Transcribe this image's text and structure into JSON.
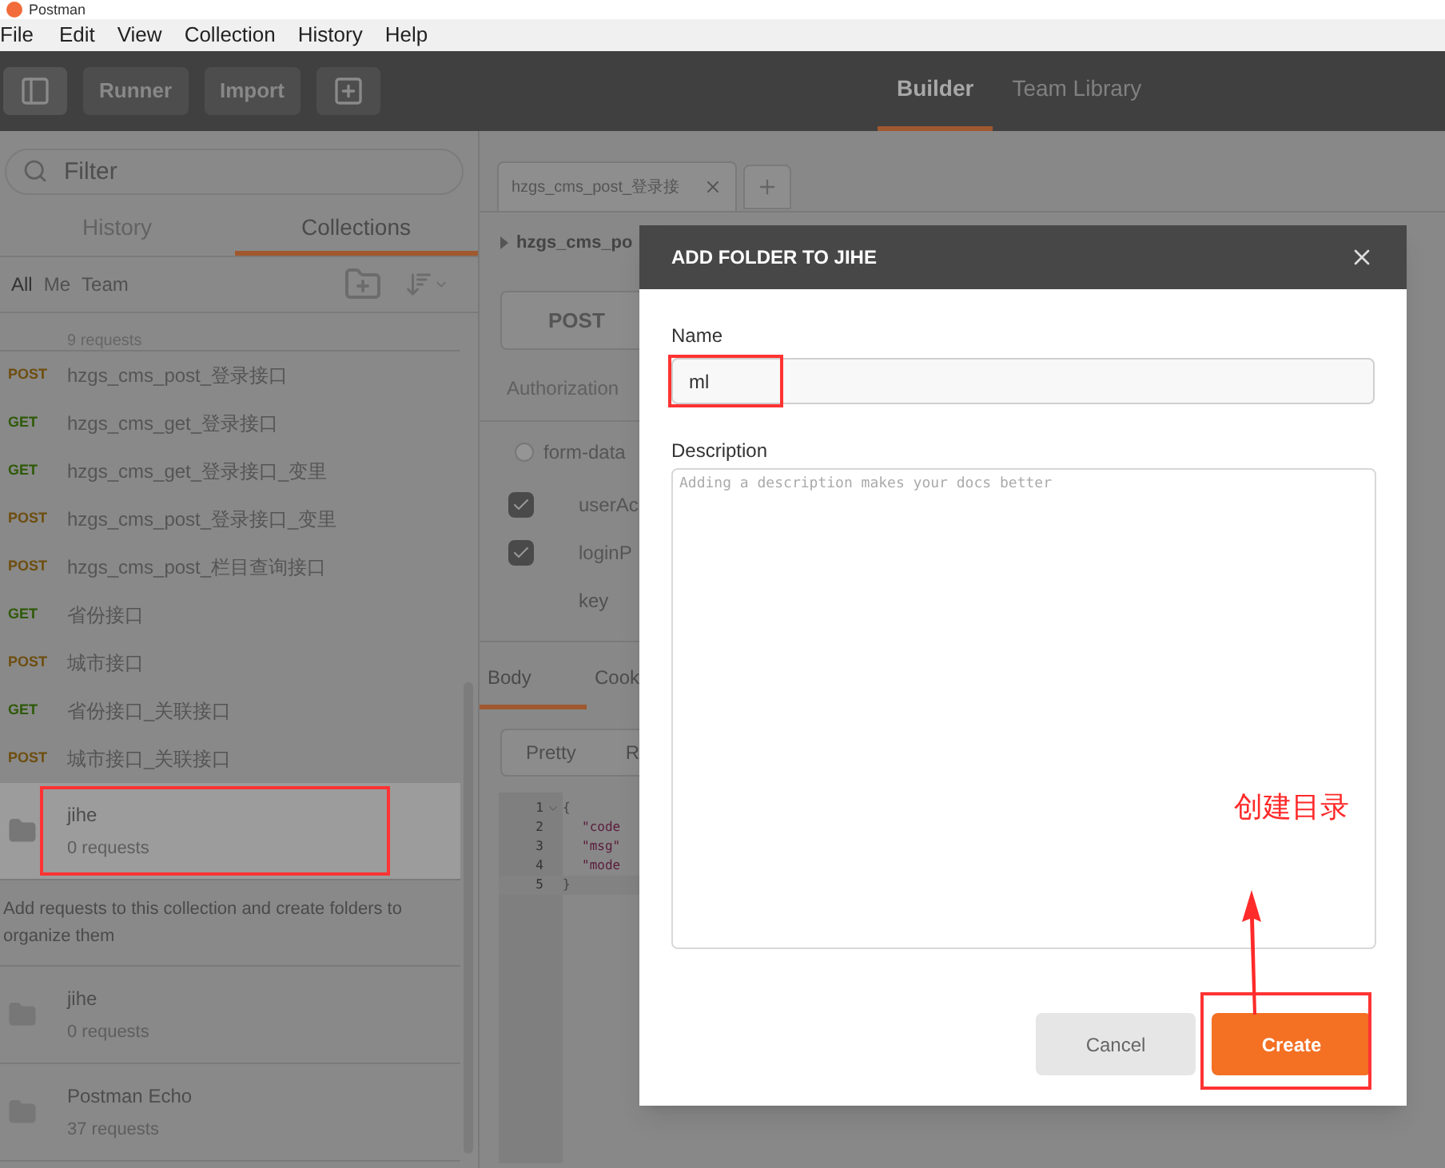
{
  "app": {
    "title": "Postman"
  },
  "menu": [
    "File",
    "Edit",
    "View",
    "Collection",
    "History",
    "Help"
  ],
  "toolbar": {
    "buttons": [
      "Runner",
      "Import"
    ],
    "tabs": [
      {
        "label": "Builder",
        "selected": true
      },
      {
        "label": "Team Library",
        "selected": false
      }
    ]
  },
  "sidebar": {
    "filter": {
      "placeholder": "Filter"
    },
    "tabs": [
      {
        "label": "History",
        "selected": false
      },
      {
        "label": "Collections",
        "selected": true
      }
    ],
    "filters": [
      {
        "label": "All",
        "selected": true
      },
      {
        "label": "Me",
        "selected": false
      },
      {
        "label": "Team",
        "selected": false
      }
    ],
    "partial_row": "9 requests",
    "requests": [
      {
        "kind": "post",
        "method": "POST",
        "name": "hzgs_cms_post_登录接口"
      },
      {
        "kind": "get",
        "method": "GET",
        "name": "hzgs_cms_get_登录接口"
      },
      {
        "kind": "get",
        "method": "GET",
        "name": "hzgs_cms_get_登录接口_变里"
      },
      {
        "kind": "post",
        "method": "POST",
        "name": "hzgs_cms_post_登录接口_变里"
      },
      {
        "kind": "post",
        "method": "POST",
        "name": "hzgs_cms_post_栏目查询接口"
      },
      {
        "kind": "get",
        "method": "GET",
        "name": "省份接口"
      },
      {
        "kind": "post",
        "method": "POST",
        "name": "城市接口"
      },
      {
        "kind": "get",
        "method": "GET",
        "name": "省份接口_关联接口"
      },
      {
        "kind": "post",
        "method": "POST",
        "name": "城市接口_关联接口"
      }
    ],
    "collections": [
      {
        "name": "jihe",
        "count": "0 requests",
        "selected": true,
        "marked": true,
        "note": "Add requests to this collection and create folders to organize them"
      },
      {
        "name": "jihe",
        "count": "0 requests",
        "selected": false,
        "marked": false
      },
      {
        "name": "Postman Echo",
        "count": "37 requests",
        "selected": false,
        "marked": false
      }
    ]
  },
  "request_tab": {
    "label": "hzgs_cms_post_登录接"
  },
  "request": {
    "breadcrumb": "hzgs_cms_po",
    "method": "POST",
    "subtab": "Authorization",
    "body_type": {
      "label": "form-data",
      "selected": false
    },
    "params": [
      {
        "kind": "param",
        "key": "userAc",
        "checked": true
      },
      {
        "kind": "param",
        "key": "loginP",
        "checked": true
      },
      {
        "kind": "new",
        "placeholder": "key"
      }
    ]
  },
  "response": {
    "tabs": [
      {
        "label": "Body",
        "selected": true
      },
      {
        "label": "Cook",
        "selected": false
      }
    ],
    "views": [
      {
        "label": "Pretty",
        "selected": true
      },
      {
        "label": "R",
        "selected": false
      }
    ],
    "lines": [
      {
        "number": "1",
        "text": "{",
        "fold": true,
        "current": false
      },
      {
        "number": "2",
        "text": "\"code",
        "fold": false,
        "current": false
      },
      {
        "number": "3",
        "text": "\"msg\"",
        "fold": false,
        "current": false
      },
      {
        "number": "4",
        "text": "\"mode",
        "fold": false,
        "current": false
      },
      {
        "number": "5",
        "text": "}",
        "fold": false,
        "current": true
      }
    ]
  },
  "dialog": {
    "title": "ADD FOLDER TO JIHE",
    "name_label": "Name",
    "name_value": "ml",
    "name_marked": true,
    "description_label": "Description",
    "description_placeholder": "Adding a description makes your docs better",
    "buttons": [
      {
        "kind": "secondary",
        "label": "Cancel",
        "marked": false
      },
      {
        "kind": "primary",
        "label": "Create",
        "marked": true
      }
    ]
  },
  "annotation": {
    "note": "创建目录"
  }
}
